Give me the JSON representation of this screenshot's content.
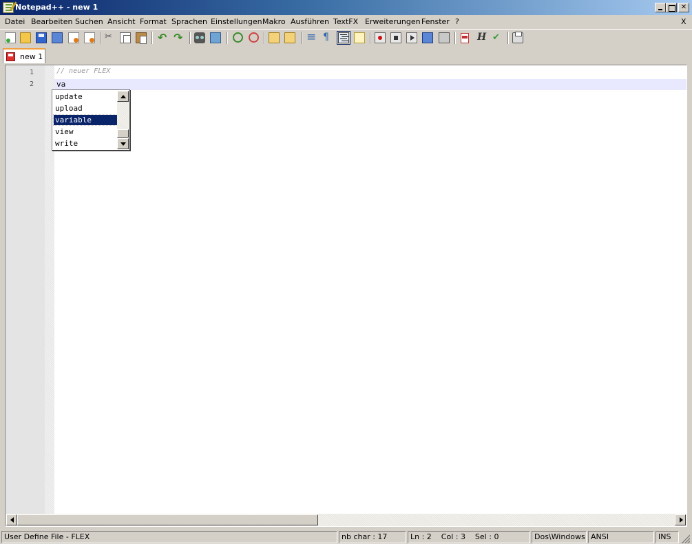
{
  "window": {
    "title": "Notepad++ - new 1",
    "doc_close_label": "X"
  },
  "menu": [
    {
      "id": "datei",
      "label": "Datei"
    },
    {
      "id": "bearbeiten",
      "label": "Bearbeiten"
    },
    {
      "id": "suchen",
      "label": "Suchen"
    },
    {
      "id": "ansicht",
      "label": "Ansicht"
    },
    {
      "id": "format",
      "label": "Format"
    },
    {
      "id": "sprachen",
      "label": "Sprachen"
    },
    {
      "id": "einstellungen",
      "label": "Einstellungen"
    },
    {
      "id": "makro",
      "label": "Makro"
    },
    {
      "id": "ausfuehren",
      "label": "Ausführen"
    },
    {
      "id": "textfx",
      "label": "TextFX"
    },
    {
      "id": "erweiterungen",
      "label": "Erweiterungen"
    },
    {
      "id": "fenster",
      "label": "Fenster"
    },
    {
      "id": "help",
      "label": "?"
    }
  ],
  "toolbar": {
    "icons": [
      "new-file-icon",
      "open-file-icon",
      "save-icon",
      "save-all-icon",
      "close-file-icon",
      "close-all-icon",
      "cut-icon",
      "copy-icon",
      "paste-icon",
      "undo-icon",
      "redo-icon",
      "find-icon",
      "replace-icon",
      "zoom-in-icon",
      "zoom-out-icon",
      "sync-vertical-icon",
      "sync-horizontal-icon",
      "word-wrap-icon",
      "show-all-chars-icon",
      "indent-guide-icon",
      "fold-all-icon",
      "record-macro-icon",
      "stop-macro-icon",
      "play-macro-icon",
      "run-macro-multiple-icon",
      "save-macro-icon",
      "pdf-icon",
      "html-icon",
      "spell-check-icon",
      "print-icon"
    ],
    "active_icon": "indent-guide-icon"
  },
  "tabs": [
    {
      "label": "new 1",
      "icon": "unsaved-file-icon",
      "active": true
    }
  ],
  "editor": {
    "line_numbers": [
      "1",
      "2"
    ],
    "lines": [
      "// neuer FLEX",
      "va"
    ],
    "current_line": 2
  },
  "autocomplete": {
    "items": [
      "update",
      "upload",
      "variable",
      "view",
      "write"
    ],
    "selected": "variable"
  },
  "status": {
    "language": "User Define File - FLEX",
    "nb_char": "nb char : 17",
    "position": "Ln : 2    Col : 3    Sel : 0",
    "eol": "Dos\\Windows",
    "encoding": "ANSI",
    "mode": "INS"
  },
  "colors": {
    "title_gradient_start": "#0a246a",
    "selection": "#0a246a",
    "current_line": "#e8e8ff",
    "comment": "#9a9a9a",
    "tab_accent": "#f0a040"
  }
}
